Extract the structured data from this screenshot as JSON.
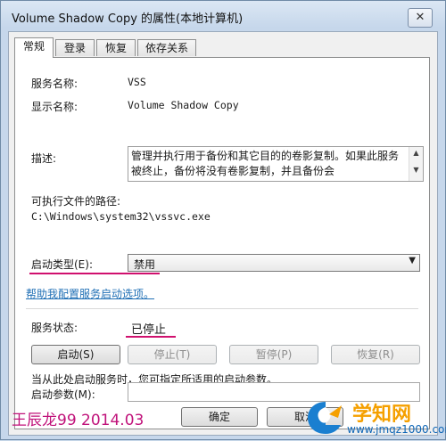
{
  "window": {
    "title": "Volume Shadow Copy 的属性(本地计算机)",
    "close_label": "✕"
  },
  "tabs": [
    {
      "label": "常规",
      "active": true
    },
    {
      "label": "登录",
      "active": false
    },
    {
      "label": "恢复",
      "active": false
    },
    {
      "label": "依存关系",
      "active": false
    }
  ],
  "general": {
    "service_name_label": "服务名称:",
    "service_name_value": "VSS",
    "display_name_label": "显示名称:",
    "display_name_value": "Volume Shadow Copy",
    "description_label": "描述:",
    "description_value": "管理并执行用于备份和其它目的的卷影复制。如果此服务被终止，备份将没有卷影复制，并且备份会",
    "exe_path_label": "可执行文件的路径:",
    "exe_path_value": "C:\\Windows\\system32\\vssvc.exe",
    "startup_type_label": "启动类型(E):",
    "startup_type_value": "禁用",
    "help_link": "帮助我配置服务启动选项。",
    "service_status_label": "服务状态:",
    "service_status_value": "已停止",
    "buttons": {
      "start": "启动(S)",
      "stop": "停止(T)",
      "pause": "暂停(P)",
      "resume": "恢复(R)"
    },
    "hint_text": "当从此处启动服务时，您可指定所适用的启动参数。",
    "start_params_label": "启动参数(M):",
    "start_params_value": ""
  },
  "footer": {
    "ok_label": "确定",
    "cancel_label": "取消"
  },
  "overlay": {
    "watermark_text": "王辰龙99  2014.03",
    "logo_title": "学知网",
    "logo_url": "www.jmqz1000.com"
  },
  "colors": {
    "accent_underline": "#d0106e",
    "link": "#1f6fb5",
    "logo_orange": "#f5a000",
    "logo_blue": "#0f66b6"
  },
  "icons": [
    "close-icon",
    "scroll-up-icon",
    "scroll-down-icon",
    "dropdown-arrow-icon",
    "logo-mark-icon"
  ]
}
